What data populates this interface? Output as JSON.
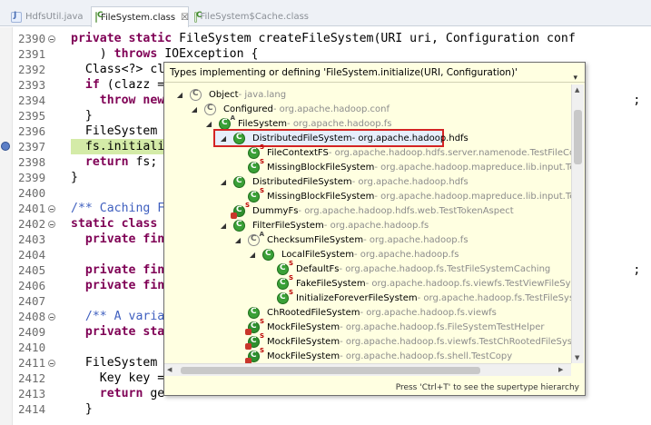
{
  "tabs": [
    {
      "label": "HdfsUtil.java",
      "icon": "java-file-icon",
      "active": false
    },
    {
      "label": "FileSystem.class",
      "icon": "class-file-icon",
      "active": true,
      "close": "☒"
    },
    {
      "label": "FileSystem$Cache.class",
      "icon": "class-file-icon",
      "active": false
    }
  ],
  "code_lines": [
    {
      "num": "2390",
      "fold": true,
      "html": "<span class=\"kw\">private</span> <span class=\"kw\">static</span> FileSystem createFileSystem(URI uri, Configuration conf"
    },
    {
      "num": "2391",
      "html": "    ) <span class=\"kw\">throws</span> IOException {"
    },
    {
      "num": "2392",
      "html": "  Class&lt;?&gt; cl"
    },
    {
      "num": "2393",
      "html": "  <span class=\"kw\">if</span> (clazz ="
    },
    {
      "num": "2394",
      "html": "    <span class=\"kw\">throw</span> <span class=\"kw\">new</span>                                                                 ;"
    },
    {
      "num": "2395",
      "html": "  }"
    },
    {
      "num": "2396",
      "html": "  FileSystem"
    },
    {
      "num": "2397",
      "hl": true,
      "bp": true,
      "html": "  fs.initiali"
    },
    {
      "num": "2398",
      "html": "  <span class=\"kw\">return</span> fs;"
    },
    {
      "num": "2399",
      "html": "}"
    },
    {
      "num": "2400",
      "html": ""
    },
    {
      "num": "2401",
      "fold": true,
      "html": "<span class=\"cm\">/** Caching F</span>"
    },
    {
      "num": "2402",
      "fold": true,
      "html": "<span class=\"kw\">static</span> <span class=\"kw\">class</span>"
    },
    {
      "num": "2403",
      "html": "  <span class=\"kw\">private</span> <span class=\"kw\">fin</span>"
    },
    {
      "num": "2404",
      "html": ""
    },
    {
      "num": "2405",
      "html": "  <span class=\"kw\">private</span> <span class=\"kw\">fin</span>                                                                 ;"
    },
    {
      "num": "2406",
      "html": "  <span class=\"kw\">private</span> <span class=\"kw\">fin</span>"
    },
    {
      "num": "2407",
      "html": ""
    },
    {
      "num": "2408",
      "fold": true,
      "html": "  <span class=\"cm\">/** A varia</span>"
    },
    {
      "num": "2409",
      "html": "  <span class=\"kw\">private</span> <span class=\"kw\">sta</span>"
    },
    {
      "num": "2410",
      "html": ""
    },
    {
      "num": "2411",
      "fold": true,
      "html": "  FileSystem"
    },
    {
      "num": "2412",
      "html": "    Key key ="
    },
    {
      "num": "2413",
      "html": "    <span class=\"kw\">return</span> ge"
    },
    {
      "num": "2414",
      "html": "  }"
    }
  ],
  "popup": {
    "title": "Types implementing or defining 'FileSystem.initialize(URI, Configuration)'",
    "menu_icon": "▾",
    "status": "Press 'Ctrl+T' to see the supertype hierarchy",
    "tree": [
      {
        "indent": 0,
        "tw": "◢",
        "icon": "grey",
        "name": "Object",
        "pkg": " - java.lang"
      },
      {
        "indent": 1,
        "tw": "◢",
        "icon": "grey",
        "name": "Configured",
        "pkg": " - org.apache.hadoop.conf"
      },
      {
        "indent": 2,
        "tw": "◢",
        "icon": "green",
        "supA": "A",
        "name": "FileSystem",
        "pkg": " - org.apache.hadoop.fs"
      },
      {
        "indent": 3,
        "tw": "◢",
        "icon": "green",
        "name": "DistributedFileSystem",
        "pkg": " - org.apache.hadoop.hdfs",
        "selected": true
      },
      {
        "indent": 4,
        "tw": "",
        "icon": "green",
        "sup": "S",
        "name": "FileContextFS",
        "pkg": " - org.apache.hadoop.hdfs.server.namenode.TestFileConte"
      },
      {
        "indent": 4,
        "tw": "",
        "icon": "green",
        "sup": "S",
        "name": "MissingBlockFileSystem",
        "pkg": " - org.apache.hadoop.mapreduce.lib.input.TestC"
      },
      {
        "indent": 3,
        "tw": "◢",
        "icon": "green",
        "name": "DistributedFileSystem",
        "pkg": " - org.apache.hadoop.hdfs"
      },
      {
        "indent": 4,
        "tw": "",
        "icon": "green",
        "sup": "S",
        "name": "MissingBlockFileSystem",
        "pkg": " - org.apache.hadoop.mapreduce.lib.input.TestC"
      },
      {
        "indent": 3,
        "tw": "",
        "icon": "red",
        "sup": "S",
        "ov": true,
        "name": "DummyFs",
        "pkg": " - org.apache.hadoop.hdfs.web.TestTokenAspect"
      },
      {
        "indent": 3,
        "tw": "◢",
        "icon": "green",
        "name": "FilterFileSystem",
        "pkg": " - org.apache.hadoop.fs"
      },
      {
        "indent": 4,
        "tw": "◢",
        "icon": "grey",
        "supA": "A",
        "name": "ChecksumFileSystem",
        "pkg": " - org.apache.hadoop.fs"
      },
      {
        "indent": 5,
        "tw": "◢",
        "icon": "green",
        "name": "LocalFileSystem",
        "pkg": " - org.apache.hadoop.fs"
      },
      {
        "indent": 6,
        "tw": "",
        "icon": "green",
        "sup": "S",
        "name": "DefaultFs",
        "pkg": " - org.apache.hadoop.fs.TestFileSystemCaching"
      },
      {
        "indent": 6,
        "tw": "",
        "icon": "green",
        "sup": "S",
        "name": "FakeFileSystem",
        "pkg": " - org.apache.hadoop.fs.viewfs.TestViewFileSyste"
      },
      {
        "indent": 6,
        "tw": "",
        "icon": "green",
        "sup": "S",
        "name": "InitializeForeverFileSystem",
        "pkg": " - org.apache.hadoop.fs.TestFileSyste"
      },
      {
        "indent": 4,
        "tw": "",
        "icon": "green",
        "name": "ChRootedFileSystem",
        "pkg": " - org.apache.hadoop.fs.viewfs"
      },
      {
        "indent": 4,
        "tw": "",
        "icon": "red",
        "sup": "S",
        "ov": true,
        "name": "MockFileSystem",
        "pkg": " - org.apache.hadoop.fs.FileSystemTestHelper"
      },
      {
        "indent": 4,
        "tw": "",
        "icon": "red",
        "sup": "S",
        "ov": true,
        "name": "MockFileSystem",
        "pkg": " - org.apache.hadoop.fs.viewfs.TestChRootedFileSystem"
      },
      {
        "indent": 4,
        "tw": "",
        "icon": "red",
        "sup": "S",
        "ov": true,
        "name": "MockFileSystem",
        "pkg": " - org.apache.hadoop.fs.shell.TestCopy"
      }
    ]
  }
}
